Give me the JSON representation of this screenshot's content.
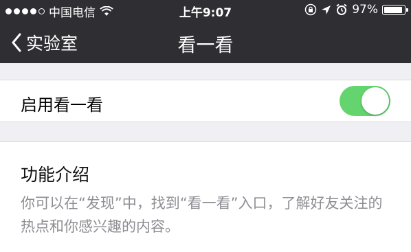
{
  "status_bar": {
    "carrier": "中国电信",
    "time": "上午9:07",
    "battery_percent": "97%",
    "battery_level": 0.97,
    "signal_bars_filled": 4,
    "signal_bars_total": 5,
    "icons": [
      "wifi-icon",
      "rotation-lock-icon",
      "location-arrow-icon",
      "alarm-icon",
      "battery-icon"
    ]
  },
  "navbar": {
    "back_label": "实验室",
    "title": "看一看",
    "background": "#2e2e33"
  },
  "settings": {
    "toggle_label": "启用看一看",
    "toggle_on": true,
    "toggle_color": "#64d56e"
  },
  "info": {
    "title": "功能介绍",
    "description": "你可以在“发现”中，找到“看一看”入口，了解好友关注的热点和你感兴趣的内容。"
  }
}
